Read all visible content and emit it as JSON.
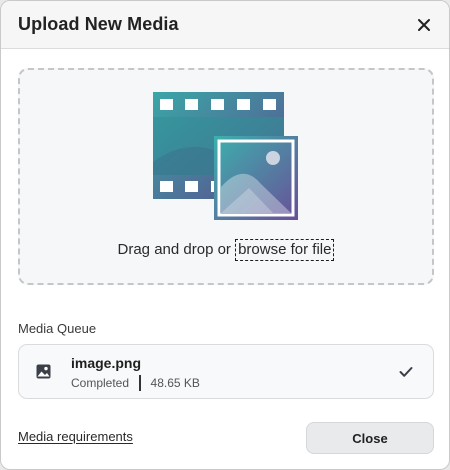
{
  "dialog": {
    "title": "Upload New Media",
    "close_icon": "close-icon"
  },
  "dropzone": {
    "illustration_icon": "film-and-image-icon",
    "text_prefix": "Drag and drop or ",
    "browse_label": "browse for file"
  },
  "queue": {
    "label": "Media Queue",
    "items": [
      {
        "icon": "image-icon",
        "name": "image.png",
        "status": "Completed",
        "size": "48.65 KB",
        "status_icon": "check-icon"
      }
    ]
  },
  "footer": {
    "requirements_link": "Media requirements",
    "close_label": "Close"
  }
}
